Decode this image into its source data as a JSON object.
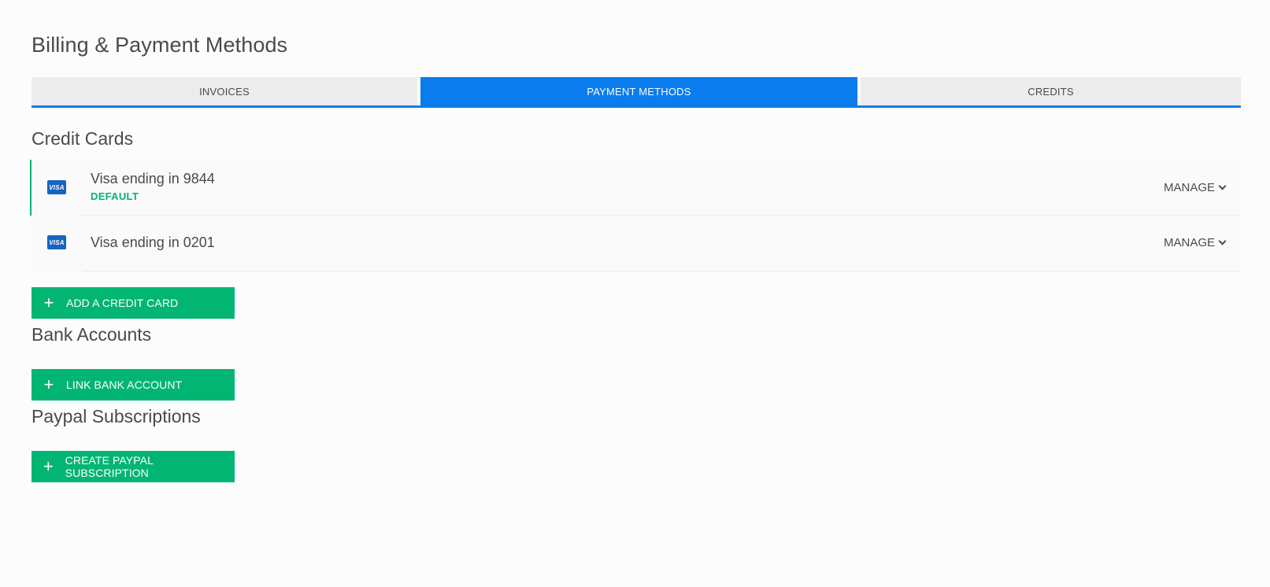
{
  "page": {
    "title": "Billing & Payment Methods"
  },
  "tabs": {
    "invoices": "INVOICES",
    "payment_methods": "PAYMENT METHODS",
    "credits": "CREDITS"
  },
  "credit_cards": {
    "section_title": "Credit Cards",
    "cards": [
      {
        "brand": "VISA",
        "label": "Visa ending in 9844",
        "badge": "DEFAULT",
        "manage": "MANAGE"
      },
      {
        "brand": "VISA",
        "label": "Visa ending in 0201",
        "manage": "MANAGE"
      }
    ],
    "add_button": "ADD A CREDIT CARD"
  },
  "bank_accounts": {
    "section_title": "Bank Accounts",
    "link_button": "LINK BANK ACCOUNT"
  },
  "paypal": {
    "section_title": "Paypal Subscriptions",
    "create_button": "CREATE PAYPAL SUBSCRIPTION"
  },
  "colors": {
    "accent_blue": "#0a7cee",
    "green": "#03b572",
    "visa_blue": "#1565c0"
  },
  "icons": {
    "card": "visa-card-icon",
    "plus": "plus-icon",
    "chevron": "chevron-down-icon"
  }
}
